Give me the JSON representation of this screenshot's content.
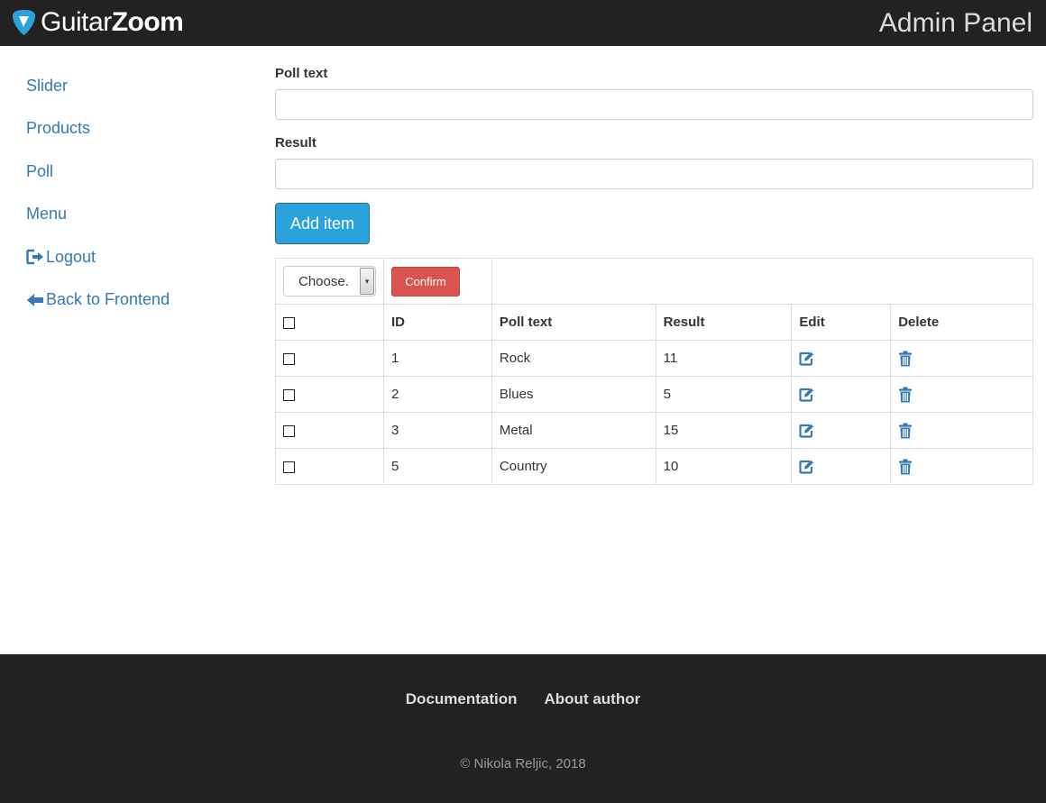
{
  "header": {
    "logo_light": "Guitar",
    "logo_bold": "Zoom",
    "title": "Admin Panel",
    "colors": {
      "background": "#222222",
      "logo_accent": "#2aa2dd"
    }
  },
  "sidebar": {
    "items": [
      {
        "label": "Slider",
        "icon": ""
      },
      {
        "label": "Products",
        "icon": ""
      },
      {
        "label": "Poll",
        "icon": ""
      },
      {
        "label": "Menu",
        "icon": ""
      },
      {
        "label": "Logout",
        "icon": "logout-icon"
      },
      {
        "label": "Back to Frontend",
        "icon": "arrow-left-icon"
      }
    ],
    "color": "#337ab7"
  },
  "form": {
    "poll_text_label": "Poll text",
    "poll_text_value": "",
    "result_label": "Result",
    "result_value": "",
    "add_button": "Add item"
  },
  "table": {
    "bulk_select": "Choose.",
    "confirm_button": "Confirm",
    "columns": [
      "",
      "ID",
      "Poll text",
      "Result",
      "Edit",
      "Delete"
    ],
    "rows": [
      {
        "id": "1",
        "poll_text": "Rock",
        "result": "11"
      },
      {
        "id": "2",
        "poll_text": "Blues",
        "result": "5"
      },
      {
        "id": "3",
        "poll_text": "Metal",
        "result": "15"
      },
      {
        "id": "5",
        "poll_text": "Country",
        "result": "10"
      }
    ],
    "edit_icon": "edit-icon",
    "delete_icon": "trash-icon"
  },
  "footer": {
    "links": [
      "Documentation",
      "About author"
    ],
    "copyright": "© Nikola Reljic, 2018"
  }
}
